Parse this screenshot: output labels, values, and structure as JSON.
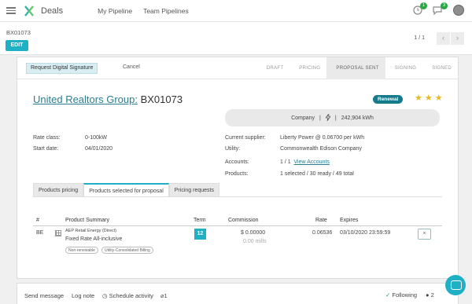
{
  "app": {
    "name": "Deals"
  },
  "nav": {
    "my_pipeline": "My Pipeline",
    "team_pipelines": "Team Pipelines",
    "badge_1": "1",
    "badge_2": "3"
  },
  "control": {
    "breadcrumb": "BX01073",
    "edit": "EDIT",
    "pager": "1 / 1",
    "prev": "‹",
    "next": "›"
  },
  "statusbar": {
    "request_signature": "Request Digital Signature",
    "cancel": "Cancel",
    "stages": [
      {
        "label": "DRAFT"
      },
      {
        "label": "PRICING"
      },
      {
        "label": "PROPOSAL SENT"
      },
      {
        "label": "SIGNING"
      },
      {
        "label": "SIGNED"
      }
    ],
    "active_stage": "PROPOSAL SENT"
  },
  "record": {
    "customer": "United Realtors Group:",
    "id": "BX01073",
    "badge": "Renewal",
    "stars": 3,
    "pill": {
      "type": "Company",
      "sep1": "|",
      "sep2": "|",
      "usage": "242,904 kWh"
    }
  },
  "fields": {
    "rate_class_label": "Rate class:",
    "rate_class": "0-100kW",
    "start_date_label": "Start date:",
    "start_date": "04/01/2020",
    "supplier_label": "Current supplier:",
    "supplier": "Liberty Power @ 0.06700 per kWh",
    "utility_label": "Utility:",
    "utility": "Commonwealth Edison Company",
    "accounts_label": "Accounts:",
    "accounts": "1 / 1",
    "view_accounts": "View Accounts",
    "products_label": "Products:",
    "products": "1 selected / 30 ready / 49 total"
  },
  "tabs": [
    "Products pricing",
    "Products selected for proposal",
    "Pricing requests"
  ],
  "table": {
    "headers": {
      "num": "#",
      "summary": "Product Summary",
      "term": "Term",
      "commission": "Commission",
      "rate": "Rate",
      "expires": "Expires"
    },
    "row": {
      "num": "BE",
      "supplier": "AEP Retail Energy (Direct)",
      "product": "Fixed Rate All-inclusive",
      "tags": [
        "Non-renewable",
        "Utility-Consolidated Billing"
      ],
      "term": "12",
      "commission": "$ 0.00000",
      "commission_mills": "0.00 mills",
      "rate": "0.06536",
      "expires": "03/10/2020 23:59:59",
      "remove": "×"
    }
  },
  "chatter": {
    "send_message": "Send message",
    "log_note": "Log note",
    "schedule": "Schedule activity",
    "attachments": "1",
    "following": "Following",
    "followers": "2"
  }
}
